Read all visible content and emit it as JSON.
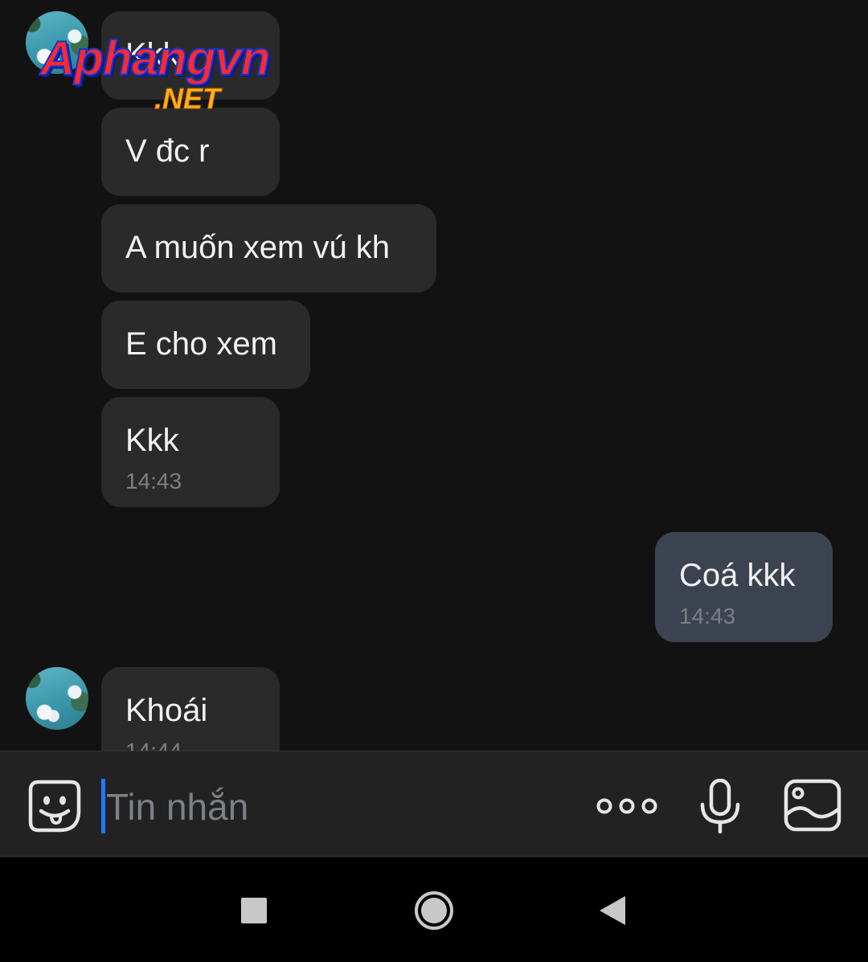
{
  "messages": [
    {
      "from": "other",
      "text": "Kkk",
      "time": ""
    },
    {
      "from": "other",
      "text": "V đc r",
      "time": ""
    },
    {
      "from": "other",
      "text": "A muốn xem vú kh",
      "time": ""
    },
    {
      "from": "other",
      "text": "E cho xem",
      "time": ""
    },
    {
      "from": "other",
      "text": "Kkk",
      "time": "14:43"
    },
    {
      "from": "me",
      "text": "Coá kkk",
      "time": "14:43"
    },
    {
      "from": "other",
      "text": "Khoái",
      "time": "14:44"
    }
  ],
  "watermark": {
    "main": "Aphangvn",
    "sub": ".NET"
  },
  "composer": {
    "placeholder": "Tin nhắn"
  },
  "icons": {
    "emoji": "sticker-emoji-icon",
    "more": "more-dots-icon",
    "mic": "microphone-icon",
    "image": "image-gallery-icon",
    "recents": "nav-recents-square-icon",
    "home": "nav-home-circle-icon",
    "back": "nav-back-triangle-icon"
  },
  "colors": {
    "background": "#121212",
    "bubble_incoming": "#2a2a2a",
    "bubble_outgoing": "#3b4350",
    "caret": "#1d79ff"
  }
}
